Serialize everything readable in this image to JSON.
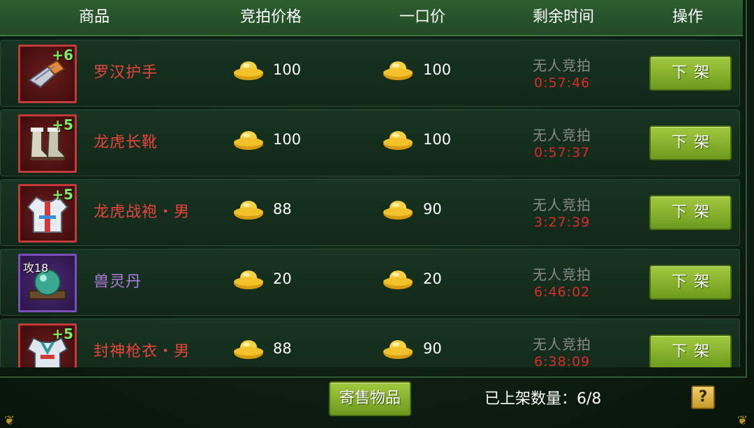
{
  "header": {
    "col_item": "商品",
    "col_bid_price": "竞拍价格",
    "col_buyout_price": "一口价",
    "col_time_left": "剩余时间",
    "col_action": "操作"
  },
  "rows": [
    {
      "name": "罗汉护手",
      "plus": "+6",
      "bid": "100",
      "buyout": "100",
      "status": "无人竞拍",
      "time": "0:57:46",
      "action": "下架",
      "rarity": "red",
      "icon": "gauntlet-icon"
    },
    {
      "name": "龙虎长靴",
      "plus": "+5",
      "bid": "100",
      "buyout": "100",
      "status": "无人竞拍",
      "time": "0:57:37",
      "action": "下架",
      "rarity": "red",
      "icon": "boots-icon"
    },
    {
      "name": "龙虎战袍・男",
      "plus": "+5",
      "bid": "88",
      "buyout": "90",
      "status": "无人竞拍",
      "time": "3:27:39",
      "action": "下架",
      "rarity": "red",
      "icon": "robe-icon"
    },
    {
      "name": "兽灵丹",
      "atk": "攻18",
      "bid": "20",
      "buyout": "20",
      "status": "无人竞拍",
      "time": "6:46:02",
      "action": "下架",
      "rarity": "purple",
      "icon": "orb-icon"
    },
    {
      "name": "封神枪衣・男",
      "plus": "+5",
      "bid": "88",
      "buyout": "90",
      "status": "无人竞拍",
      "time": "6:38:09",
      "action": "下架",
      "rarity": "red",
      "icon": "armor-icon"
    }
  ],
  "footer": {
    "consign_label": "寄售物品",
    "listed_count_label": "已上架数量：6/8",
    "help_label": "?"
  },
  "colors": {
    "header_bg": "#2d5e2f",
    "item_name_red": "#e8443b",
    "item_name_purple": "#b07ae0",
    "timer_red": "#e02a2a",
    "button_green": "#8bb531"
  }
}
